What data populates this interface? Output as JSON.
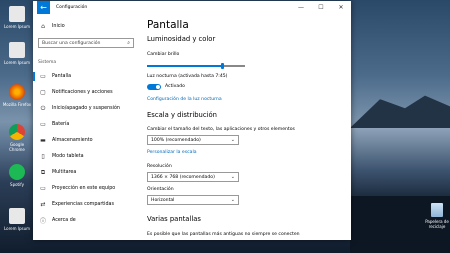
{
  "desktop": {
    "icons": [
      {
        "label": "Lorem Ipsum",
        "color": "#e8e8e8"
      },
      {
        "label": "Lorem Ipsum",
        "color": "#e8e8e8"
      },
      {
        "label": "Mozilla Firefox",
        "color": "#e66000"
      },
      {
        "label": "Google Chrome",
        "color": "#2aa44f"
      },
      {
        "label": "Spotify",
        "color": "#1db954"
      },
      {
        "label": "Lorem Ipsum",
        "color": "#e8e8e8"
      }
    ],
    "recycle_bin": {
      "label": "Papelera de reciclaje"
    }
  },
  "window": {
    "title": "Configuración",
    "controls": {
      "minimize": "—",
      "maximize": "☐",
      "close": "✕"
    }
  },
  "sidebar": {
    "home": "Inicio",
    "search_placeholder": "Buscar una configuración",
    "section": "Sistema",
    "items": [
      {
        "label": "Pantalla",
        "icon": "monitor-icon",
        "selected": true
      },
      {
        "label": "Notificaciones y acciones",
        "icon": "notifications-icon"
      },
      {
        "label": "Inicio/apagado y suspensión",
        "icon": "power-icon"
      },
      {
        "label": "Batería",
        "icon": "battery-icon"
      },
      {
        "label": "Almacenamiento",
        "icon": "storage-icon"
      },
      {
        "label": "Modo tableta",
        "icon": "tablet-icon"
      },
      {
        "label": "Multitarea",
        "icon": "multitask-icon"
      },
      {
        "label": "Proyección en este equipo",
        "icon": "projection-icon"
      },
      {
        "label": "Experiencias compartidas",
        "icon": "shared-icon"
      },
      {
        "label": "Acerca de",
        "icon": "info-icon"
      }
    ]
  },
  "main": {
    "title": "Pantalla",
    "brightness_heading": "Luminosidad y color",
    "brightness_label": "Cambiar brillo",
    "brightness_level_percent": 77,
    "night_light_label": "Luz nocturna (activada hasta 7:45)",
    "night_light_state": "Activado",
    "night_light_link": "Configuración de la luz nocturna",
    "scale_heading": "Escala y distribución",
    "scale_label": "Cambiar el tamaño del texto, las aplicaciones y otros elementos",
    "scale_value": "100% (recomendado)",
    "scale_link": "Personalizar la escala",
    "resolution_label": "Resolución",
    "resolution_value": "1366 × 768 (recomendado)",
    "orientation_label": "Orientación",
    "orientation_value": "Horizontal",
    "multi_heading": "Varias pantallas",
    "multi_text": "Es posible que las pantallas más antiguas no siempre se conecten"
  }
}
